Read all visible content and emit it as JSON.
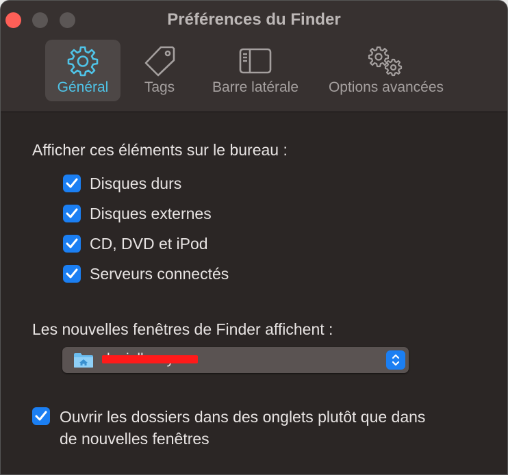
{
  "window": {
    "title": "Préférences du Finder"
  },
  "tabs": [
    {
      "label": "Général",
      "icon": "gear-icon",
      "selected": true
    },
    {
      "label": "Tags",
      "icon": "tag-icon",
      "selected": false
    },
    {
      "label": "Barre latérale",
      "icon": "sidebar-icon",
      "selected": false
    },
    {
      "label": "Options avancées",
      "icon": "gears-icon",
      "selected": false
    }
  ],
  "desktop_section": {
    "heading": "Afficher ces éléments sur le bureau :",
    "items": [
      {
        "label": "Disques durs",
        "checked": true
      },
      {
        "label": "Disques externes",
        "checked": true
      },
      {
        "label": "CD, DVD et iPod",
        "checked": true
      },
      {
        "label": "Serveurs connectés",
        "checked": true
      }
    ]
  },
  "new_windows": {
    "heading": "Les nouvelles fenêtres de Finder affichent :",
    "selected_value": "daniellaazy",
    "icon": "home-folder-icon"
  },
  "tabs_option": {
    "label": "Ouvrir les dossiers dans des onglets plutôt que dans de nouvelles fenêtres",
    "checked": true
  },
  "colors": {
    "accent": "#1b7ff3",
    "selected_tab_text": "#4fc4e8",
    "close_button": "#fe5f57",
    "redaction": "#ff1a1a"
  }
}
